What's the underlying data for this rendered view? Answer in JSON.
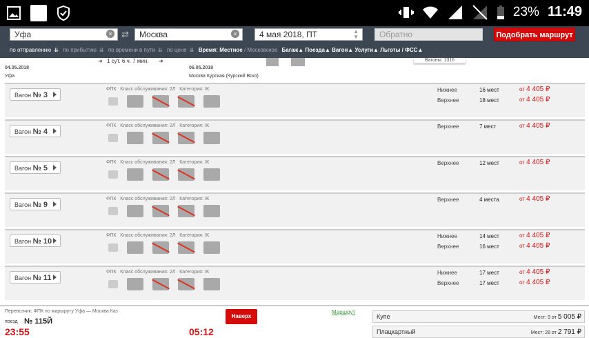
{
  "status": {
    "battery": "23%",
    "time": "11:49"
  },
  "search": {
    "from": "Уфа",
    "to": "Москва",
    "date": "4 мая 2018, ПТ",
    "back_placeholder": "Обратно",
    "submit": "Подобрать маршрут"
  },
  "sort": {
    "by_departure": "по отправлению",
    "by_arrival": "по прибытию",
    "by_duration": "по времени в пути",
    "by_price": "по цене",
    "time_label": "Время:",
    "time_local": "Местное",
    "time_moscow": "/ Московское",
    "baggage": "Багаж",
    "trains": "Поезда",
    "wagon": "Вагон",
    "services": "Услуги",
    "benefits": "Льготы / ФСС"
  },
  "train": {
    "dep_date": "04.05.2018",
    "dep_station": "Уфа",
    "duration": "1 сут. 6 ч. 7 мин.",
    "arr_date": "06.05.2018",
    "arr_station": "Москва Курская (Курский Вокз)",
    "partial": "Вагоны: 1316"
  },
  "wagons": [
    {
      "label": "Вагон",
      "num": "№ 3",
      "carrier": "ФПК",
      "class": "Класс обслуживания: 2Л",
      "category": "Категория: Ж",
      "seats": [
        {
          "type": "Нижнее",
          "count": "16 мест",
          "from": "от",
          "price": "4 405 ₽"
        },
        {
          "type": "Верхнее",
          "count": "18 мест",
          "from": "от",
          "price": "4 405 ₽"
        }
      ]
    },
    {
      "label": "Вагон",
      "num": "№ 4",
      "carrier": "ФПК",
      "class": "Класс обслуживания: 2Л",
      "category": "Категория: Ж",
      "seats": [
        {
          "type": "Верхнее",
          "count": "7 мест",
          "from": "от",
          "price": "4 405 ₽"
        }
      ]
    },
    {
      "label": "Вагон",
      "num": "№ 5",
      "carrier": "ФПК",
      "class": "Класс обслуживания: 2Л",
      "category": "Категория: Ж",
      "seats": [
        {
          "type": "Верхнее",
          "count": "12 мест",
          "from": "от",
          "price": "4 405 ₽"
        }
      ]
    },
    {
      "label": "Вагон",
      "num": "№ 9",
      "carrier": "ФПК",
      "class": "Класс обслуживания: 2Л",
      "category": "Категория: Ж",
      "seats": [
        {
          "type": "Верхнее",
          "count": "4 места",
          "from": "от",
          "price": "4 405 ₽"
        }
      ]
    },
    {
      "label": "Вагон",
      "num": "№ 10",
      "carrier": "ФПК",
      "class": "Класс обслуживания: 2Л",
      "category": "Категория: Ж",
      "seats": [
        {
          "type": "Нижнее",
          "count": "14 мест",
          "from": "от",
          "price": "4 405 ₽"
        },
        {
          "type": "Верхнее",
          "count": "16 мест",
          "from": "от",
          "price": "4 405 ₽"
        }
      ]
    },
    {
      "label": "Вагон",
      "num": "№ 11",
      "carrier": "ФПК",
      "class": "Класс обслуживания: 2Л",
      "category": "Категория: Ж",
      "seats": [
        {
          "type": "Нижнее",
          "count": "17 мест",
          "from": "от",
          "price": "4 405 ₽"
        },
        {
          "type": "Верхнее",
          "count": "17 мест",
          "from": "от",
          "price": "4 405 ₽"
        }
      ]
    }
  ],
  "footer": {
    "carrier_line": "Перевозчик: ФПК   по маршруту Уфа — Москва Каз",
    "route_link": "Маршрут",
    "up_button": "Наверх",
    "train_prefix": "поезд",
    "train_num": "№ 115Й",
    "dep_time": "23:55",
    "arr_time": "05:12",
    "classes": [
      {
        "name": "Купе",
        "seats": "Мест: 9",
        "from": "от",
        "price": "5 005 ₽"
      },
      {
        "name": "Плацкартный",
        "seats": "Мест: 28",
        "from": "от",
        "price": "2 791 ₽"
      }
    ]
  }
}
